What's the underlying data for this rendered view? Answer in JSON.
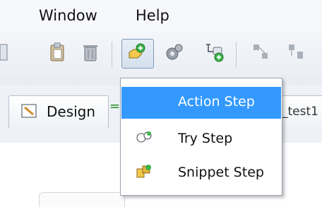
{
  "menubar": {
    "items": [
      {
        "label": "Window"
      },
      {
        "label": "Help"
      }
    ]
  },
  "toolbar": {
    "icons": [
      "page-icon",
      "clipboard-icon",
      "trash-icon",
      "add-action-step-icon",
      "gears-icon",
      "add-branch-icon",
      "node-icon",
      "node-icon-2"
    ]
  },
  "tabs": {
    "design_label": "Design",
    "test_label": "_test1"
  },
  "dropdown": {
    "items": [
      {
        "label": "Action Step",
        "selected": true
      },
      {
        "label": "Try Step",
        "icon": "try-step-icon"
      },
      {
        "label": "Snippet Step",
        "icon": "snippet-step-icon"
      }
    ]
  },
  "colors": {
    "selection": "#3399ff",
    "toolbar_bg": "#eaeef4"
  }
}
